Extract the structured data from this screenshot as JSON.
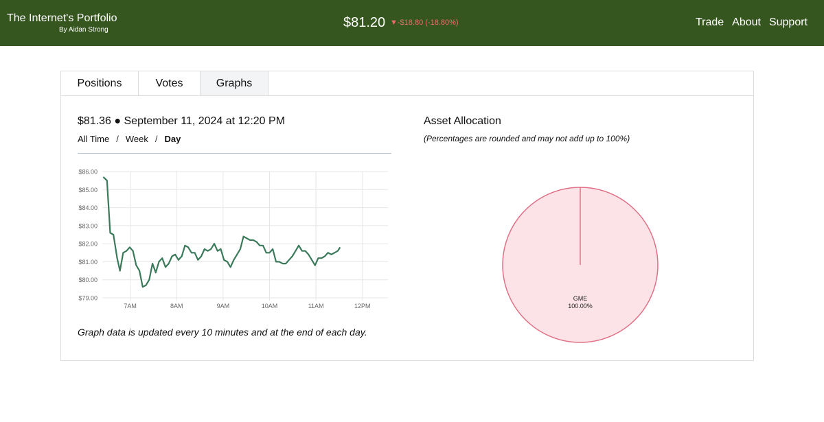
{
  "header": {
    "title": "The Internet's Portfolio",
    "subtitle": "By Aidan Strong",
    "price": "$81.20",
    "change": "▼-$18.80 (-18.80%)",
    "nav": [
      "Trade",
      "About",
      "Support"
    ],
    "colors": {
      "bar": "#36561f",
      "negative": "#f06a6a"
    }
  },
  "tabs": [
    {
      "label": "Positions",
      "active": false
    },
    {
      "label": "Votes",
      "active": false
    },
    {
      "label": "Graphs",
      "active": true
    }
  ],
  "graph": {
    "headline": "$81.36 ● September 11, 2024 at 12:20 PM",
    "ranges": [
      "All Time",
      "Week",
      "Day"
    ],
    "separator": "/",
    "active_range": "Day",
    "note": "Graph data is updated every 10 minutes and at the end of each day."
  },
  "allocation": {
    "title": "Asset Allocation",
    "note": "(Percentages are rounded and may not add up to 100%)"
  },
  "chart_data": [
    {
      "type": "line",
      "x_ticks": [
        "7AM",
        "8AM",
        "9AM",
        "10AM",
        "11AM",
        "12PM"
      ],
      "y_ticks": [
        "$79.00",
        "$80.00",
        "$81.00",
        "$82.00",
        "$83.00",
        "$84.00",
        "$85.00",
        "$86.00"
      ],
      "ylim": [
        79,
        86
      ],
      "x_hours_range": [
        6.4,
        12.55
      ],
      "grid": true,
      "series": [
        {
          "color": "#3a7a5a",
          "points": [
            [
              6.42,
              85.7
            ],
            [
              6.5,
              85.5
            ],
            [
              6.57,
              82.6
            ],
            [
              6.64,
              82.5
            ],
            [
              6.72,
              81.2
            ],
            [
              6.78,
              80.5
            ],
            [
              6.85,
              81.5
            ],
            [
              6.92,
              81.6
            ],
            [
              6.99,
              81.8
            ],
            [
              7.06,
              81.6
            ],
            [
              7.13,
              80.8
            ],
            [
              7.2,
              80.5
            ],
            [
              7.27,
              79.6
            ],
            [
              7.34,
              79.7
            ],
            [
              7.41,
              80.0
            ],
            [
              7.48,
              80.9
            ],
            [
              7.55,
              80.4
            ],
            [
              7.62,
              81.0
            ],
            [
              7.69,
              81.2
            ],
            [
              7.76,
              80.7
            ],
            [
              7.83,
              80.9
            ],
            [
              7.9,
              81.3
            ],
            [
              7.97,
              81.4
            ],
            [
              8.04,
              81.1
            ],
            [
              8.11,
              81.3
            ],
            [
              8.18,
              81.9
            ],
            [
              8.25,
              81.8
            ],
            [
              8.32,
              81.5
            ],
            [
              8.39,
              81.5
            ],
            [
              8.46,
              81.1
            ],
            [
              8.53,
              81.3
            ],
            [
              8.6,
              81.7
            ],
            [
              8.67,
              81.6
            ],
            [
              8.74,
              81.7
            ],
            [
              8.81,
              82.0
            ],
            [
              8.88,
              81.6
            ],
            [
              8.95,
              81.7
            ],
            [
              9.02,
              81.1
            ],
            [
              9.09,
              81.0
            ],
            [
              9.16,
              80.7
            ],
            [
              9.23,
              81.1
            ],
            [
              9.3,
              81.4
            ],
            [
              9.37,
              81.7
            ],
            [
              9.44,
              82.4
            ],
            [
              9.51,
              82.3
            ],
            [
              9.58,
              82.2
            ],
            [
              9.65,
              82.2
            ],
            [
              9.72,
              82.1
            ],
            [
              9.79,
              81.9
            ],
            [
              9.86,
              81.9
            ],
            [
              9.93,
              81.5
            ],
            [
              10.0,
              81.5
            ],
            [
              10.07,
              81.7
            ],
            [
              10.14,
              81.0
            ],
            [
              10.21,
              81.0
            ],
            [
              10.28,
              80.9
            ],
            [
              10.35,
              80.9
            ],
            [
              10.42,
              81.1
            ],
            [
              10.49,
              81.3
            ],
            [
              10.56,
              81.6
            ],
            [
              10.63,
              81.9
            ],
            [
              10.7,
              81.6
            ],
            [
              10.77,
              81.6
            ],
            [
              10.84,
              81.4
            ],
            [
              10.91,
              81.1
            ],
            [
              10.98,
              80.8
            ],
            [
              11.05,
              81.2
            ],
            [
              11.12,
              81.2
            ],
            [
              11.19,
              81.3
            ],
            [
              11.26,
              81.5
            ],
            [
              11.33,
              81.4
            ],
            [
              11.4,
              81.5
            ],
            [
              11.47,
              81.6
            ],
            [
              11.52,
              81.8
            ]
          ]
        }
      ]
    },
    {
      "type": "pie",
      "slices": [
        {
          "label": "GME",
          "value_label": "100.00%",
          "value": 100,
          "color": "#fbe3e8",
          "stroke": "#e07085"
        }
      ]
    }
  ]
}
